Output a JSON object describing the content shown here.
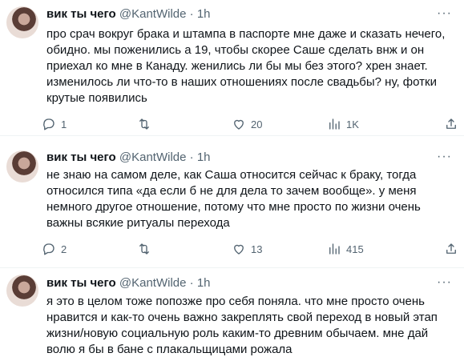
{
  "tweets": [
    {
      "author_name": "вик ты чего",
      "author_handle": "@KantWilde",
      "separator": "·",
      "time": "1h",
      "text": "про срач вокруг брака и штампа в паспорте мне даже и сказать нечего, обидно. мы поженились а 19, чтобы скорее Саше сделать внж и он приехал ко мне в Канаду. женились ли бы мы без этого? хрен знает. изменилось ли что-то в наших отношениях после свадьбы? ну, фотки крутые появились",
      "replies": "1",
      "retweets": "",
      "likes": "20",
      "views": "1K"
    },
    {
      "author_name": "вик ты чего",
      "author_handle": "@KantWilde",
      "separator": "·",
      "time": "1h",
      "text": "не знаю на самом деле, как Саша относится сейчас к браку, тогда относился типа «да если б не для дела то зачем вообще». у меня немного другое отношение, потому что мне просто по жизни очень важны всякие ритуалы перехода",
      "replies": "2",
      "retweets": "",
      "likes": "13",
      "views": "415"
    },
    {
      "author_name": "вик ты чего",
      "author_handle": "@KantWilde",
      "separator": "·",
      "time": "1h",
      "text": "я это в целом тоже попозже про себя поняла. что мне просто очень нравится и как-то очень важно закреплять свой переход в новый этап жизни/новую социальную роль каким-то древним обычаем. мне дай волю я бы в бане с плакальщицами рожала"
    }
  ],
  "icons": {
    "more": "more-horizontal-icon",
    "reply": "reply-icon",
    "retweet": "retweet-icon",
    "like": "heart-icon",
    "views": "views-chart-icon"
  },
  "colors": {
    "text": "#0f1419",
    "secondary": "#536471",
    "divider": "#eff3f4"
  }
}
